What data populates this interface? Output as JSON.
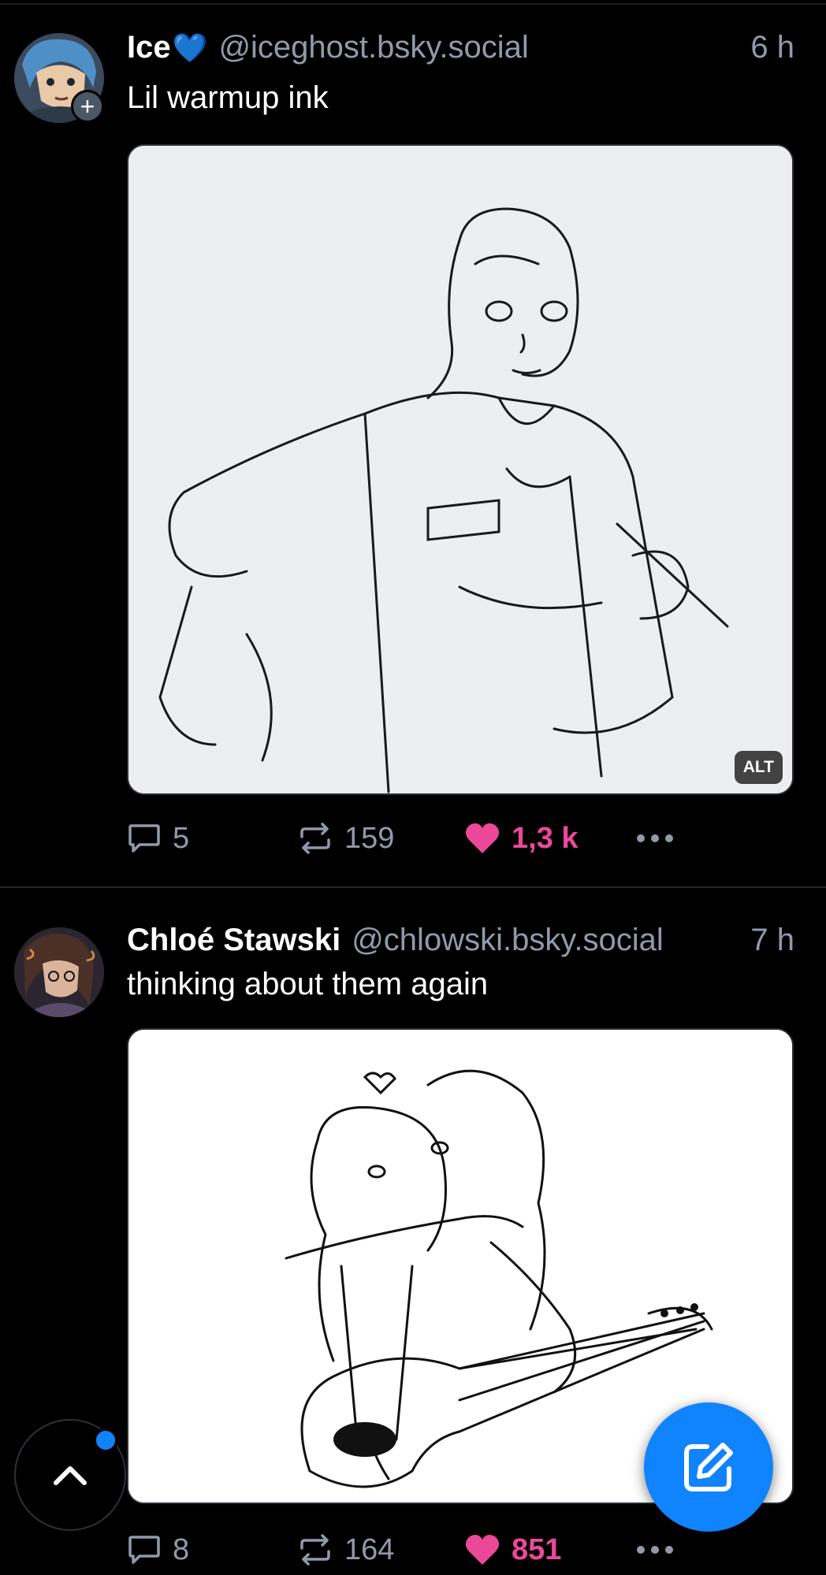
{
  "colors": {
    "background": "#000000",
    "text": "#ffffff",
    "muted": "#8f9bab",
    "like": "#ec4899",
    "accent": "#1083fe"
  },
  "posts": [
    {
      "display_name": "Ice",
      "name_emoji": "💙",
      "handle": "@iceghost.bsky.social",
      "time": "6 h",
      "text": "Lil warmup ink",
      "image_alt_badge": "ALT",
      "has_follow_badge": true,
      "follow_badge": "+",
      "counts": {
        "replies": "5",
        "reposts": "159",
        "likes": "1,3 k"
      },
      "liked": true
    },
    {
      "display_name": "Chloé Stawski",
      "handle": "@chlowski.bsky.social",
      "time": "7 h",
      "text": "thinking about them again",
      "counts": {
        "replies": "8",
        "reposts": "164",
        "likes": "851"
      },
      "liked": true
    }
  ],
  "icons": {
    "reply": "speech-bubble-icon",
    "repost": "repost-arrows-icon",
    "like": "heart-icon",
    "more": "ellipsis-icon",
    "scroll_top": "chevron-up-icon",
    "compose": "pencil-square-icon"
  }
}
